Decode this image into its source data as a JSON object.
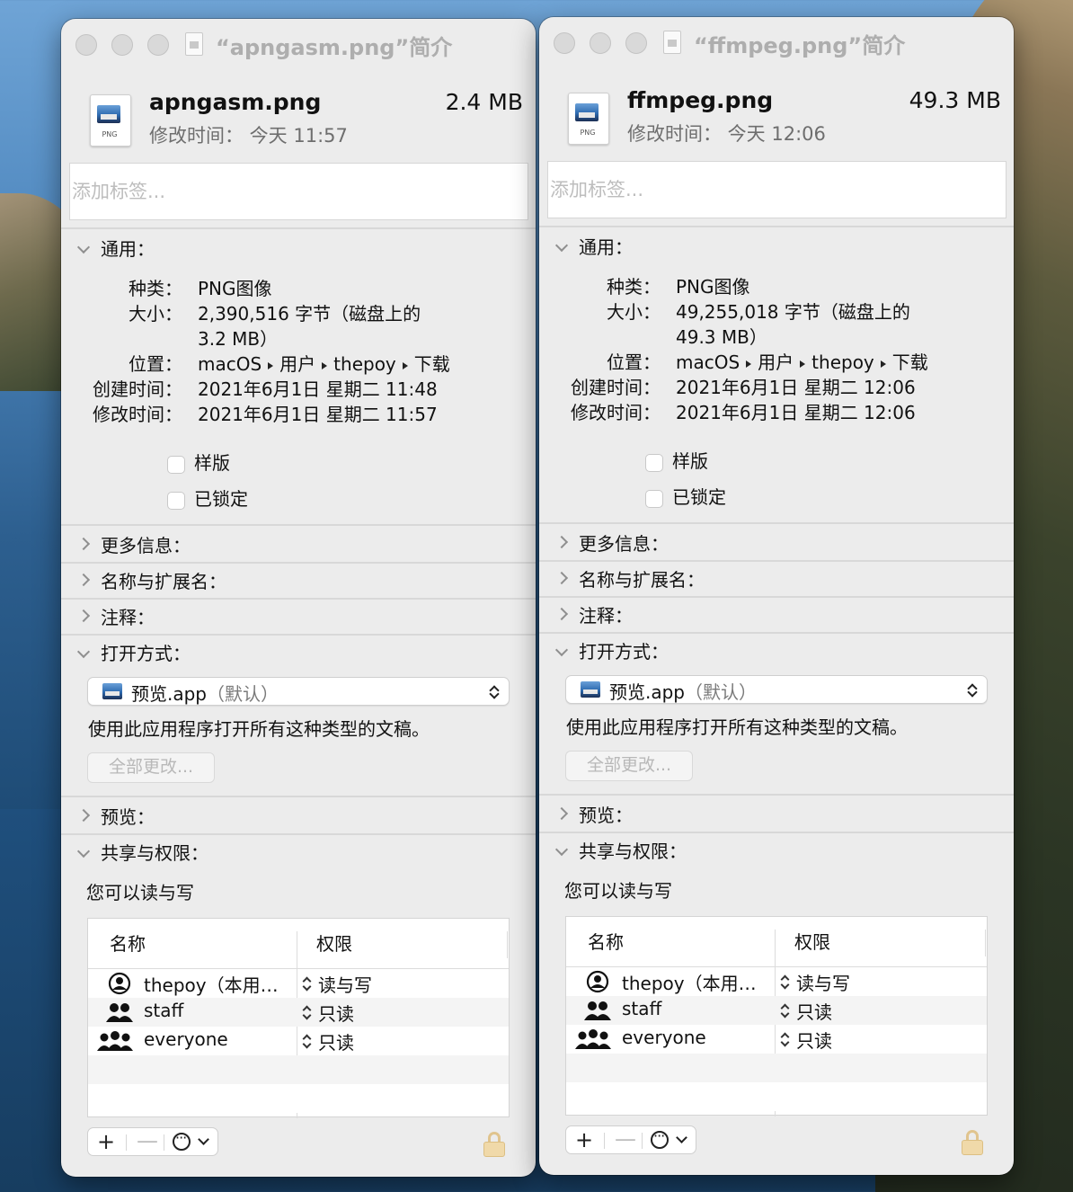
{
  "windows": [
    {
      "title": "“apngasm.png”简介",
      "file_name": "apngasm.png",
      "file_size": "2.4 MB",
      "modified": "修改时间：  今天 11:57",
      "file_type_badge": "PNG",
      "tags_placeholder": "添加标签...",
      "general": {
        "header": "通用：",
        "kind_label": "种类：",
        "kind_value": "PNG图像",
        "size_label": "大小：",
        "size_value_line1": "2,390,516 字节（磁盘上的",
        "size_value_line2": "3.2 MB）",
        "where_label": "位置：",
        "where_path": [
          "macOS",
          "用户",
          "thepoy",
          "下载"
        ],
        "created_label": "创建时间：",
        "created_value": "2021年6月1日 星期二 11:48",
        "modified_label": "修改时间：",
        "modified_value": "2021年6月1日 星期二 11:57",
        "stationery_label": "样版",
        "locked_label": "已锁定"
      },
      "more_info": "更多信息：",
      "name_ext": "名称与扩展名：",
      "comments": "注释：",
      "open_with": {
        "header": "打开方式：",
        "app": "预览.app",
        "default_tag": "（默认）",
        "description": "使用此应用程序打开所有这种类型的文稿。",
        "change_all": "全部更改..."
      },
      "preview": "预览：",
      "sharing": {
        "header": "共享与权限：",
        "summary": "您可以读与写",
        "col_name": "名称",
        "col_priv": "权限",
        "rows": [
          {
            "icon": "person-circle-icon",
            "name": "thepoy（本用…",
            "perm": "读与写"
          },
          {
            "icon": "two-people-icon",
            "name": "staff",
            "perm": "只读"
          },
          {
            "icon": "three-people-icon",
            "name": "everyone",
            "perm": "只读"
          }
        ],
        "add": "+",
        "remove": "—"
      }
    },
    {
      "title": "“ffmpeg.png”简介",
      "file_name": "ffmpeg.png",
      "file_size": "49.3 MB",
      "modified": "修改时间：  今天 12:06",
      "file_type_badge": "PNG",
      "tags_placeholder": "添加标签...",
      "general": {
        "header": "通用：",
        "kind_label": "种类：",
        "kind_value": "PNG图像",
        "size_label": "大小：",
        "size_value_line1": "49,255,018 字节（磁盘上的",
        "size_value_line2": "49.3 MB）",
        "where_label": "位置：",
        "where_path": [
          "macOS",
          "用户",
          "thepoy",
          "下载"
        ],
        "created_label": "创建时间：",
        "created_value": "2021年6月1日 星期二 12:06",
        "modified_label": "修改时间：",
        "modified_value": "2021年6月1日 星期二 12:06",
        "stationery_label": "样版",
        "locked_label": "已锁定"
      },
      "more_info": "更多信息：",
      "name_ext": "名称与扩展名：",
      "comments": "注释：",
      "open_with": {
        "header": "打开方式：",
        "app": "预览.app",
        "default_tag": "（默认）",
        "description": "使用此应用程序打开所有这种类型的文稿。",
        "change_all": "全部更改..."
      },
      "preview": "预览：",
      "sharing": {
        "header": "共享与权限：",
        "summary": "您可以读与写",
        "col_name": "名称",
        "col_priv": "权限",
        "rows": [
          {
            "icon": "person-circle-icon",
            "name": "thepoy（本用…",
            "perm": "读与写"
          },
          {
            "icon": "two-people-icon",
            "name": "staff",
            "perm": "只读"
          },
          {
            "icon": "three-people-icon",
            "name": "everyone",
            "perm": "只读"
          }
        ],
        "add": "+",
        "remove": "—"
      }
    }
  ]
}
